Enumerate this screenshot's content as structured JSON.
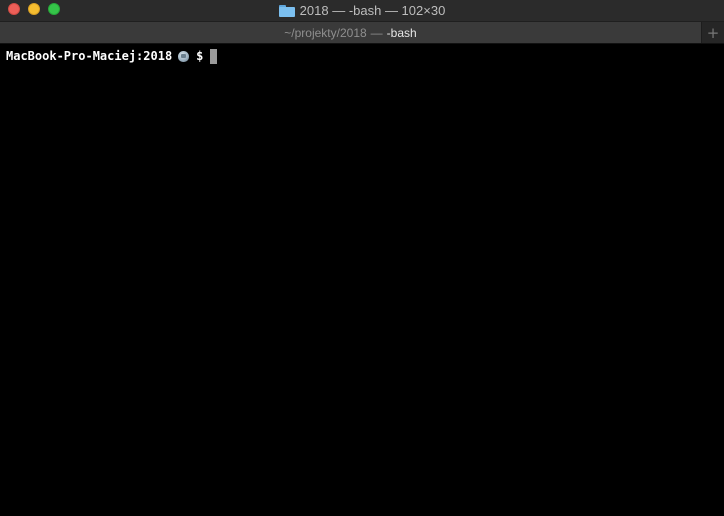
{
  "window": {
    "title": "2018 — -bash — 102×30",
    "folder_icon": "folder-icon"
  },
  "tab": {
    "path": "~/projekty/2018",
    "separator": "—",
    "process": "-bash",
    "new_tab_label": "+"
  },
  "terminal": {
    "prompt_host": "MacBook-Pro-Maciej:2018",
    "prompt_icon": "lightbulb-icon",
    "prompt_symbol": "$"
  },
  "colors": {
    "close": "#ed5f58",
    "minimize": "#f5bd30",
    "zoom": "#35c449",
    "background": "#000000",
    "text": "#ffffff"
  }
}
